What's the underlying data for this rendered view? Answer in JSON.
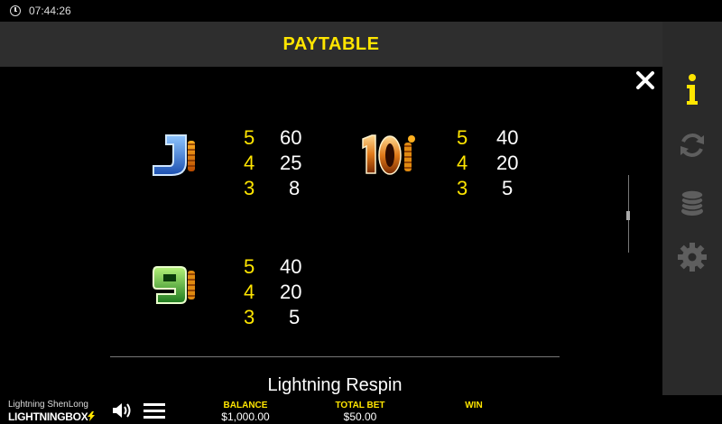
{
  "status_bar": {
    "time": "07:44:26",
    "icon": "clock-icon"
  },
  "header": {
    "title": "PAYTABLE"
  },
  "sidebar": {
    "icons": [
      "info-icon",
      "autoplay-icon",
      "coins-icon",
      "gear-icon"
    ]
  },
  "paytable": {
    "symbols": [
      {
        "name": "J",
        "icon": "symbol-j-icon",
        "pays": [
          {
            "count": "5",
            "amount": "60"
          },
          {
            "count": "4",
            "amount": "25"
          },
          {
            "count": "3",
            "amount": "8"
          }
        ]
      },
      {
        "name": "10",
        "icon": "symbol-10-icon",
        "pays": [
          {
            "count": "5",
            "amount": "40"
          },
          {
            "count": "4",
            "amount": "20"
          },
          {
            "count": "3",
            "amount": "5"
          }
        ]
      },
      {
        "name": "9",
        "icon": "symbol-9-icon",
        "pays": [
          {
            "count": "5",
            "amount": "40"
          },
          {
            "count": "4",
            "amount": "20"
          },
          {
            "count": "3",
            "amount": "5"
          }
        ]
      }
    ],
    "next_section_title": "Lightning Respin"
  },
  "footer": {
    "game_name": "Lightning ShenLong",
    "brand_a": "LIGHTNING",
    "brand_b": "BOX",
    "balance_label": "BALANCE",
    "balance_value": "$1,000.00",
    "total_bet_label": "TOTAL BET",
    "total_bet_value": "$50.00",
    "win_label": "WIN",
    "win_value": ""
  },
  "colors": {
    "accent": "#ffe500",
    "header_bg": "#2e2e2e",
    "sidebar_bg": "#2a2a2a"
  }
}
